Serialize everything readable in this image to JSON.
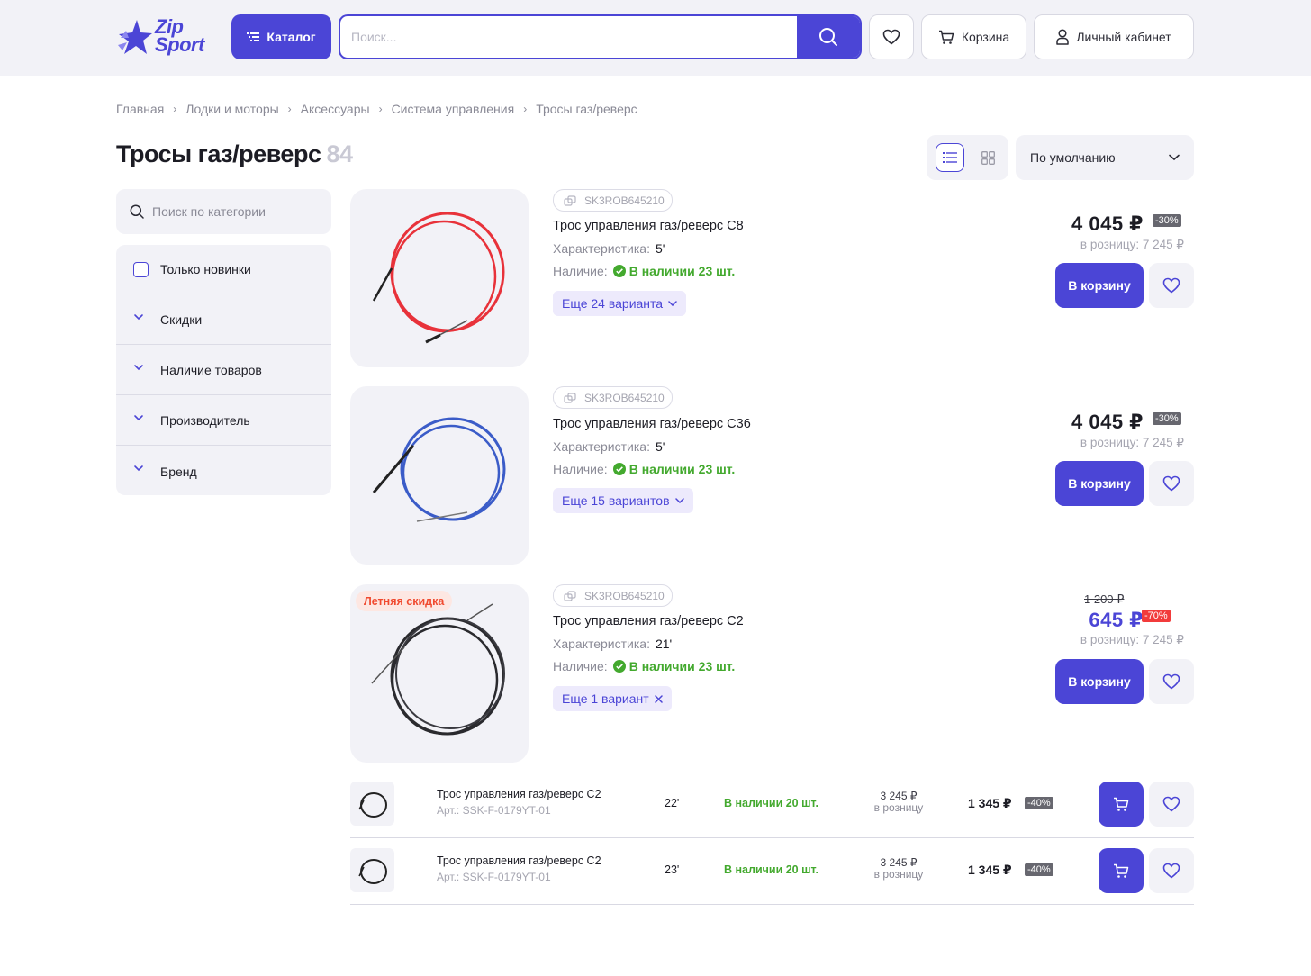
{
  "header": {
    "logo_line1": "Zip",
    "logo_line2": "Sport",
    "catalog_label": "Каталог",
    "search_placeholder": "Поиск...",
    "cart_label": "Корзина",
    "account_label": "Личный кабинет"
  },
  "breadcrumb": [
    "Главная",
    "Лодки и моторы",
    "Аксессуары",
    "Система управления",
    "Тросы газ/реверс"
  ],
  "page": {
    "title": "Тросы газ/реверс",
    "count": "84",
    "sort_value": "По умолчанию"
  },
  "sidebar": {
    "search_placeholder": "Поиск по категории",
    "new_only_label": "Только новинки",
    "filters": [
      "Скидки",
      "Наличие товаров",
      "Производитель",
      "Бренд"
    ]
  },
  "labels": {
    "characteristic": "Характеристика:",
    "availability": "Наличие:",
    "to_cart": "В корзину"
  },
  "products": [
    {
      "sku": "SK3ROB645210",
      "name": "Трос управления газ/реверс  C8",
      "characteristic": "5'",
      "availability": "В наличии 23 шт.",
      "variants": "Еще 24 варианта",
      "price": "4 045 ₽",
      "discount": "-30%",
      "retail": "в розницу: 7 245 ₽"
    },
    {
      "sku": "SK3ROB645210",
      "name": "Трос управления газ/реверс  C36",
      "characteristic": "5'",
      "availability": "В наличии 23 шт.",
      "variants": "Еще 15 вариантов",
      "price": "4 045 ₽",
      "discount": "-30%",
      "retail": "в розницу: 7 245 ₽"
    },
    {
      "sku": "SK3ROB645210",
      "name": "Трос управления газ/реверс  C2",
      "characteristic": "21'",
      "availability": "В наличии 23 шт.",
      "variants": "Еще 1 вариант",
      "old_price": "1 200 ₽",
      "price": "645 ₽",
      "discount": "-70%",
      "retail": "в розницу: 7 245 ₽",
      "promo": "Летняя скидка"
    }
  ],
  "variant_rows": [
    {
      "name": "Трос управления газ/реверс  C2",
      "art": "Арт.: SSK-F-0179YT-01",
      "characteristic": "22'",
      "availability": "В наличии 20 шт.",
      "retail_price": "3 245 ₽",
      "retail_label": "в розницу",
      "price": "1 345 ₽",
      "discount": "-40%"
    },
    {
      "name": "Трос управления газ/реверс  C2",
      "art": "Арт.: SSK-F-0179YT-01",
      "characteristic": "23'",
      "availability": "В наличии 20 шт.",
      "retail_price": "3 245 ₽",
      "retail_label": "в розницу",
      "price": "1 345 ₽",
      "discount": "-40%"
    }
  ],
  "colors": {
    "accent": "#4b45d6",
    "stock_green": "#43a92e",
    "sale_red": "#f23b3b",
    "cable_red": "#e8323a",
    "cable_blue": "#3b5cc8",
    "cable_black": "#2a2a2e"
  }
}
